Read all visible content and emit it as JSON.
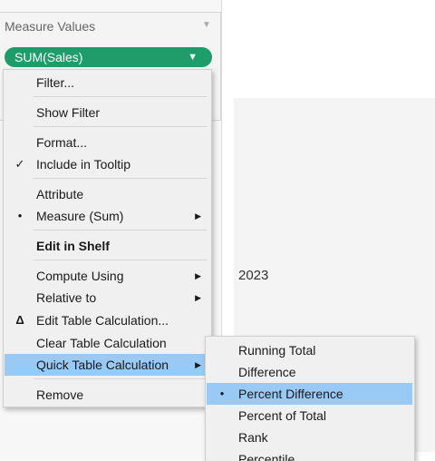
{
  "shelf": {
    "title": "Measure Values",
    "caret": "▼",
    "pill_label": "SUM(Sales)",
    "pill_caret": "▼",
    "pill_color": "#1e9d6a"
  },
  "canvas": {
    "year_label": "2023"
  },
  "context_menu": {
    "items": [
      {
        "label": "Filter..."
      },
      {
        "label": "Show Filter"
      },
      {
        "label": "Format..."
      },
      {
        "label": "Include in Tooltip",
        "mark": "✓"
      },
      {
        "label": "Attribute"
      },
      {
        "label": "Measure (Sum)",
        "mark": "•",
        "arrow": "▶"
      },
      {
        "label": "Edit in Shelf"
      },
      {
        "label": "Compute Using",
        "arrow": "▶"
      },
      {
        "label": "Relative to",
        "arrow": "▶"
      },
      {
        "label": "Edit Table Calculation...",
        "mark": "Δ"
      },
      {
        "label": "Clear Table Calculation"
      },
      {
        "label": "Quick Table Calculation",
        "arrow": "▶"
      },
      {
        "label": "Remove"
      }
    ],
    "highlight_color": "#99c9f5"
  },
  "submenu": {
    "items": [
      {
        "label": "Running Total"
      },
      {
        "label": "Difference"
      },
      {
        "label": "Percent Difference",
        "mark": "•"
      },
      {
        "label": "Percent of Total"
      },
      {
        "label": "Rank"
      },
      {
        "label": "Percentile"
      }
    ]
  }
}
